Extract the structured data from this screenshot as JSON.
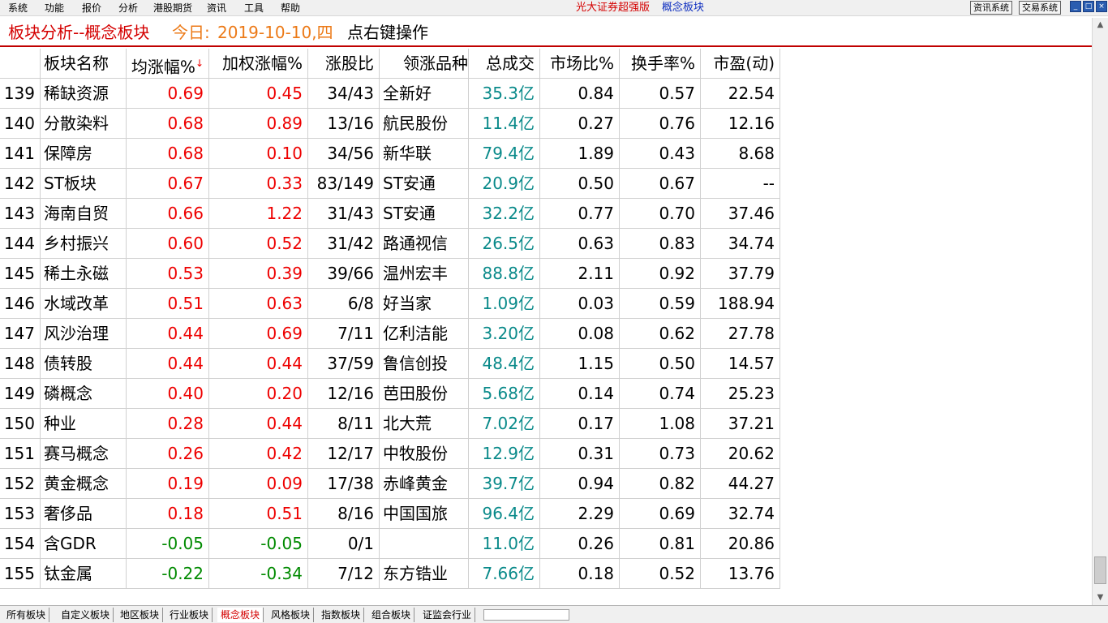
{
  "menu": [
    "系统",
    "功能",
    "报价",
    "分析",
    "港股期货",
    "资讯",
    "工具",
    "帮助"
  ],
  "app_title": "光大证券超强版",
  "module_title": "概念板块",
  "sys_buttons": [
    "资讯系统",
    "交易系统"
  ],
  "win_controls": [
    "_",
    "□",
    "×"
  ],
  "header": {
    "title": "板块分析--概念板块",
    "today_label": "今日:",
    "date": "2019-10-10,四",
    "hint": "点右键操作"
  },
  "columns": [
    "",
    "板块名称",
    "均涨幅%",
    "加权涨幅%",
    "涨股比",
    "领涨品种",
    "总成交",
    "市场比%",
    "换手率%",
    "市盈(动)"
  ],
  "sort_arrow": "↓",
  "colors": {
    "up": "#ee0000",
    "down": "#008a00",
    "volume": "#0a8a8a",
    "title_red": "#d40000",
    "date_orange": "#ec7a18"
  },
  "rows": [
    {
      "no": "139",
      "name": "稀缺资源",
      "avg": "0.69",
      "wavg": "0.45",
      "ratio": "34/43",
      "leader": "全新好",
      "vol": "35.3亿",
      "mkt": "0.84",
      "turn": "0.57",
      "pe": "22.54",
      "dir": "up"
    },
    {
      "no": "140",
      "name": "分散染料",
      "avg": "0.68",
      "wavg": "0.89",
      "ratio": "13/16",
      "leader": "航民股份",
      "vol": "11.4亿",
      "mkt": "0.27",
      "turn": "0.76",
      "pe": "12.16",
      "dir": "up"
    },
    {
      "no": "141",
      "name": "保障房",
      "avg": "0.68",
      "wavg": "0.10",
      "ratio": "34/56",
      "leader": "新华联",
      "vol": "79.4亿",
      "mkt": "1.89",
      "turn": "0.43",
      "pe": "8.68",
      "dir": "up"
    },
    {
      "no": "142",
      "name": "ST板块",
      "avg": "0.67",
      "wavg": "0.33",
      "ratio": "83/149",
      "leader": "ST安通",
      "vol": "20.9亿",
      "mkt": "0.50",
      "turn": "0.67",
      "pe": "--",
      "dir": "up"
    },
    {
      "no": "143",
      "name": "海南自贸",
      "avg": "0.66",
      "wavg": "1.22",
      "ratio": "31/43",
      "leader": "ST安通",
      "vol": "32.2亿",
      "mkt": "0.77",
      "turn": "0.70",
      "pe": "37.46",
      "dir": "up"
    },
    {
      "no": "144",
      "name": "乡村振兴",
      "avg": "0.60",
      "wavg": "0.52",
      "ratio": "31/42",
      "leader": "路通视信",
      "vol": "26.5亿",
      "mkt": "0.63",
      "turn": "0.83",
      "pe": "34.74",
      "dir": "up"
    },
    {
      "no": "145",
      "name": "稀土永磁",
      "avg": "0.53",
      "wavg": "0.39",
      "ratio": "39/66",
      "leader": "温州宏丰",
      "vol": "88.8亿",
      "mkt": "2.11",
      "turn": "0.92",
      "pe": "37.79",
      "dir": "up"
    },
    {
      "no": "146",
      "name": "水域改革",
      "avg": "0.51",
      "wavg": "0.63",
      "ratio": "6/8",
      "leader": "好当家",
      "vol": "1.09亿",
      "mkt": "0.03",
      "turn": "0.59",
      "pe": "188.94",
      "dir": "up"
    },
    {
      "no": "147",
      "name": "风沙治理",
      "avg": "0.44",
      "wavg": "0.69",
      "ratio": "7/11",
      "leader": "亿利洁能",
      "vol": "3.20亿",
      "mkt": "0.08",
      "turn": "0.62",
      "pe": "27.78",
      "dir": "up"
    },
    {
      "no": "148",
      "name": "债转股",
      "avg": "0.44",
      "wavg": "0.44",
      "ratio": "37/59",
      "leader": "鲁信创投",
      "vol": "48.4亿",
      "mkt": "1.15",
      "turn": "0.50",
      "pe": "14.57",
      "dir": "up"
    },
    {
      "no": "149",
      "name": "磷概念",
      "avg": "0.40",
      "wavg": "0.20",
      "ratio": "12/16",
      "leader": "芭田股份",
      "vol": "5.68亿",
      "mkt": "0.14",
      "turn": "0.74",
      "pe": "25.23",
      "dir": "up"
    },
    {
      "no": "150",
      "name": "种业",
      "avg": "0.28",
      "wavg": "0.44",
      "ratio": "8/11",
      "leader": "北大荒",
      "vol": "7.02亿",
      "mkt": "0.17",
      "turn": "1.08",
      "pe": "37.21",
      "dir": "up"
    },
    {
      "no": "151",
      "name": "赛马概念",
      "avg": "0.26",
      "wavg": "0.42",
      "ratio": "12/17",
      "leader": "中牧股份",
      "vol": "12.9亿",
      "mkt": "0.31",
      "turn": "0.73",
      "pe": "20.62",
      "dir": "up"
    },
    {
      "no": "152",
      "name": "黄金概念",
      "avg": "0.19",
      "wavg": "0.09",
      "ratio": "17/38",
      "leader": "赤峰黄金",
      "vol": "39.7亿",
      "mkt": "0.94",
      "turn": "0.82",
      "pe": "44.27",
      "dir": "up"
    },
    {
      "no": "153",
      "name": "奢侈品",
      "avg": "0.18",
      "wavg": "0.51",
      "ratio": "8/16",
      "leader": "中国国旅",
      "vol": "96.4亿",
      "mkt": "2.29",
      "turn": "0.69",
      "pe": "32.74",
      "dir": "up"
    },
    {
      "no": "154",
      "name": "含GDR",
      "avg": "-0.05",
      "wavg": "-0.05",
      "ratio": "0/1",
      "leader": "",
      "vol": "11.0亿",
      "mkt": "0.26",
      "turn": "0.81",
      "pe": "20.86",
      "dir": "down"
    },
    {
      "no": "155",
      "name": "钛金属",
      "avg": "-0.22",
      "wavg": "-0.34",
      "ratio": "7/12",
      "leader": "东方锆业",
      "vol": "7.66亿",
      "mkt": "0.18",
      "turn": "0.52",
      "pe": "13.76",
      "dir": "down"
    }
  ],
  "tabs": [
    "所有板块",
    "自定义板块",
    "地区板块",
    "行业板块",
    "概念板块",
    "风格板块",
    "指数板块",
    "组合板块",
    "证监会行业"
  ],
  "active_tab": "概念板块"
}
